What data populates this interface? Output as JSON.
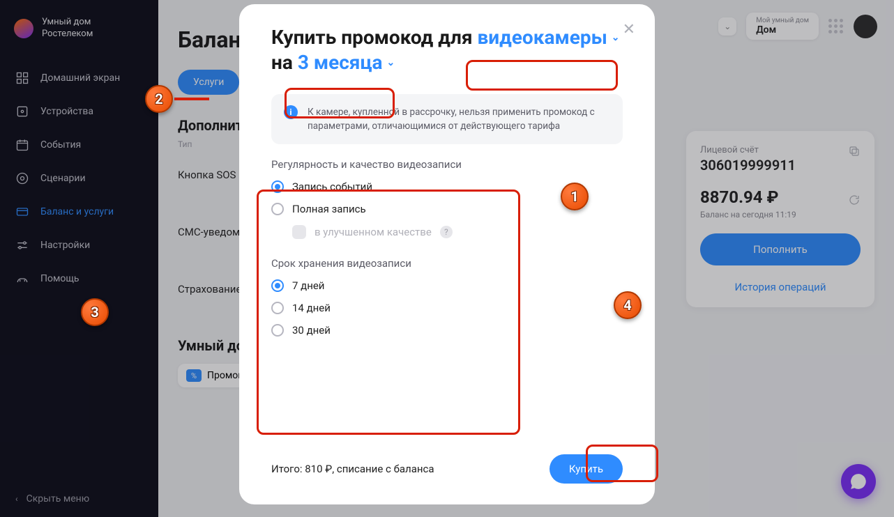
{
  "brand": {
    "line1": "Умный дом",
    "line2": "Ростелеком"
  },
  "nav": {
    "home": "Домашний экран",
    "devices": "Устройства",
    "events": "События",
    "scenarios": "Сценарии",
    "balance": "Баланс и услуги",
    "settings": "Настройки",
    "help": "Помощь"
  },
  "hide_menu": "Скрыть меню",
  "header": {
    "my_home_label": "Мой умный дом",
    "home_name": "Дом"
  },
  "main": {
    "title": "Баланс",
    "services_pill": "Услуги",
    "section1": "Дополнительно",
    "col_type": "Тип",
    "row_sos": "Кнопка SOS",
    "row_sms": "СМС-уведомления",
    "row_ins": "Страхование",
    "section2": "Умный дом",
    "promo": "Промокоды"
  },
  "account_card": {
    "label": "Лицевой счёт",
    "number": "306019999911",
    "balance": "8870.94 ₽",
    "subtitle": "Баланс на сегодня 11:19",
    "topup": "Пополнить",
    "history": "История операций"
  },
  "modal": {
    "title_prefix": "Купить промокод для",
    "dropdown_device": "видеокамеры",
    "title_join": "на",
    "dropdown_period": "3 месяца",
    "info": "К камере, купленной в рассрочку, нельзя применить промокод с параметрами, отличающимися от действующего тарифа",
    "reg_title": "Регулярность и качество видеозаписи",
    "opt_events": "Запись событий",
    "opt_full": "Полная запись",
    "opt_quality": "в улучшенном качестве",
    "storage_title": "Срок хранения видеозаписи",
    "days7": "7 дней",
    "days14": "14 дней",
    "days30": "30 дней",
    "total": "Итого: 810 ₽, списание с баланса",
    "buy": "Купить"
  },
  "callouts": {
    "n1": "1",
    "n2": "2",
    "n3": "3",
    "n4": "4"
  }
}
